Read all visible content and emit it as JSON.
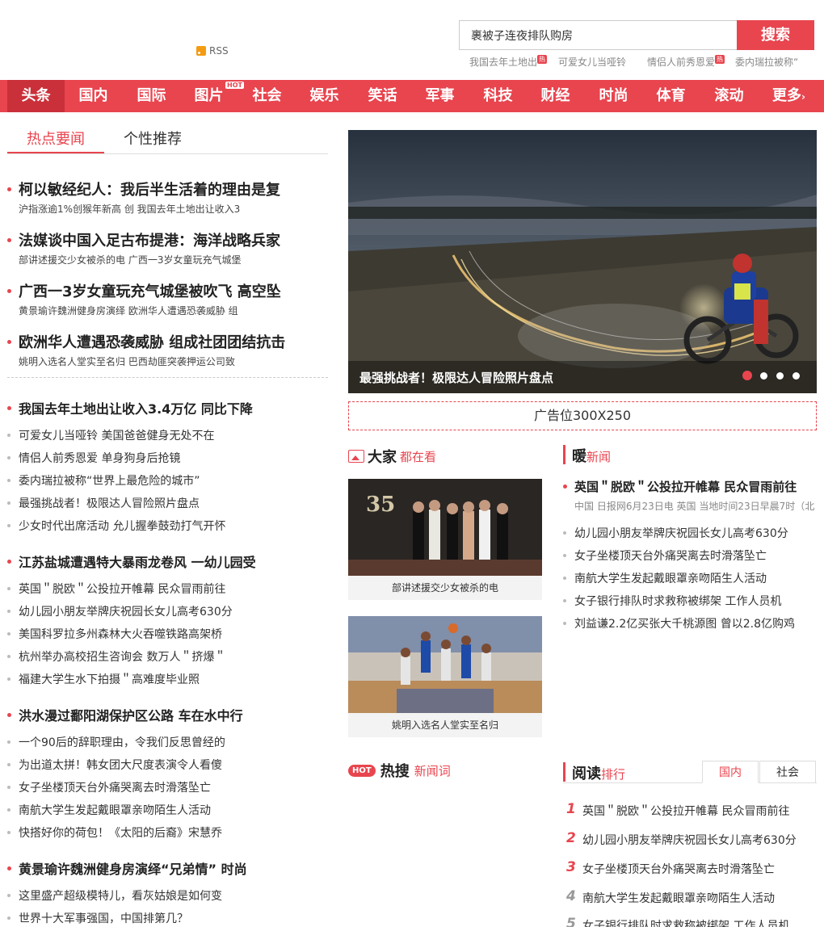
{
  "header": {
    "rss_label": "RSS",
    "search_value": "裹被子连夜排队购房",
    "search_button": "搜索",
    "hotwords": [
      "我国去年土地出",
      "可爱女儿当哑铃",
      "情侣人前秀恩爱",
      "委内瑞拉被称“"
    ],
    "hot_tag": "热"
  },
  "nav": {
    "items": [
      "头条",
      "国内",
      "国际",
      "图片",
      "社会",
      "娱乐",
      "笑话",
      "军事",
      "科技",
      "财经",
      "时尚",
      "体育",
      "滚动",
      "更多"
    ],
    "hot_badge": "HOT",
    "more_arrow": "›"
  },
  "left": {
    "tabs": [
      "热点要闻",
      "个性推荐"
    ],
    "headlines": [
      {
        "title": "柯以敏经纪人：我后半生活着的理由是复",
        "sub": "沪指涨逾1%创猴年新高 创   我国去年土地出让收入3"
      },
      {
        "title": "法媒谈中国入足古布提港：海洋战略兵家",
        "sub": "部讲述援交少女被杀的电   广西一3岁女童玩充气城堡"
      },
      {
        "title": "广西一3岁女童玩充气城堡被吹飞 高空坠",
        "sub": "黄景瑜许魏洲健身房演绎   欧洲华人遭遇恐袭威胁 组"
      },
      {
        "title": "欧洲华人遭遇恐袭威胁 组成社团团结抗击",
        "sub": "姚明入选名人堂实至名归   巴西劫匪突袭押运公司致"
      }
    ],
    "groups": [
      {
        "title": "我国去年土地出让收入3.4万亿 同比下降",
        "items": [
          "可爱女儿当哑铃 美国爸爸健身无处不在",
          "情侣人前秀恩爱 单身狗身后抢镜",
          "委内瑞拉被称“世界上最危险的城市”",
          "最强挑战者！极限达人冒险照片盘点",
          "少女时代出席活动 允儿握拳鼓劲打气开怀"
        ]
      },
      {
        "title": "江苏盐城遭遇特大暴雨龙卷风 一幼儿园受",
        "items": [
          "英国＂脱欧＂公投拉开帷幕 民众冒雨前往",
          "幼儿园小朋友举牌庆祝园长女儿高考630分",
          "美国科罗拉多州森林大火吞噬铁路高架桥",
          "杭州举办高校招生咨询会 数万人＂挤爆＂",
          "福建大学生水下拍摄＂高难度毕业照"
        ]
      },
      {
        "title": "洪水漫过鄱阳湖保护区公路 车在水中行",
        "items": [
          "一个90后的辞职理由，令我们反思曾经的",
          "为出道太拼！韩女团大尺度表演令人看傻",
          "女子坐楼顶天台外痛哭离去时滑落坠亡",
          "南航大学生发起戴眼罩亲吻陌生人活动",
          "快搭好你的荷包！《太阳的后裔》宋慧乔"
        ]
      },
      {
        "title": "黄景瑜许魏洲健身房演绎“兄弟情”  时尚",
        "items": [
          "这里盛产超级模特儿，看灰姑娘是如何变",
          "世界十大军事强国，中国排第几？"
        ]
      }
    ]
  },
  "slider": {
    "caption": "最强挑战者！极限达人冒险照片盘点",
    "dots": 4,
    "active_dot": 0
  },
  "ad": {
    "text": "广告位300X250"
  },
  "dajia": {
    "title_big": "大家",
    "title_red": "都在看",
    "cards": [
      {
        "caption": "部讲述援交少女被杀的电",
        "badge": "35"
      },
      {
        "caption": "姚明入选名人堂实至名归"
      }
    ]
  },
  "nuan": {
    "title_big": "暖",
    "title_red": "新闻",
    "main_title": "英国＂脱欧＂公投拉开帷幕 民众冒雨前往",
    "main_sub": "中国 日报网6月23日电 英国 当地时间23日早晨7时（北",
    "items": [
      "幼儿园小朋友举牌庆祝园长女儿高考630分",
      "女子坐楼顶天台外痛哭离去时滑落坠亡",
      "南航大学生发起戴眼罩亲吻陌生人活动",
      "女子银行排队时求救称被绑架 工作人员机",
      "刘益谦2.2亿买张大千桃源图 曾以2.8亿购鸡"
    ]
  },
  "hot": {
    "badge": "HOT",
    "title_big": "热搜",
    "title_red": "新闻词"
  },
  "yuedu": {
    "title_big": "阅读",
    "title_red": "排行",
    "tabs": [
      "国内",
      "社会"
    ],
    "items": [
      {
        "n": "1",
        "t": "英国＂脱欧＂公投拉开帷幕 民众冒雨前往"
      },
      {
        "n": "2",
        "t": "幼儿园小朋友举牌庆祝园长女儿高考630分"
      },
      {
        "n": "3",
        "t": "女子坐楼顶天台外痛哭离去时滑落坠亡"
      },
      {
        "n": "4",
        "t": "南航大学生发起戴眼罩亲吻陌生人活动"
      },
      {
        "n": "5",
        "t": "女子银行排队时求救称被绑架 工作人员机"
      }
    ]
  },
  "colors": {
    "accent": "#e8454f",
    "accent_dark": "#c9303a"
  }
}
